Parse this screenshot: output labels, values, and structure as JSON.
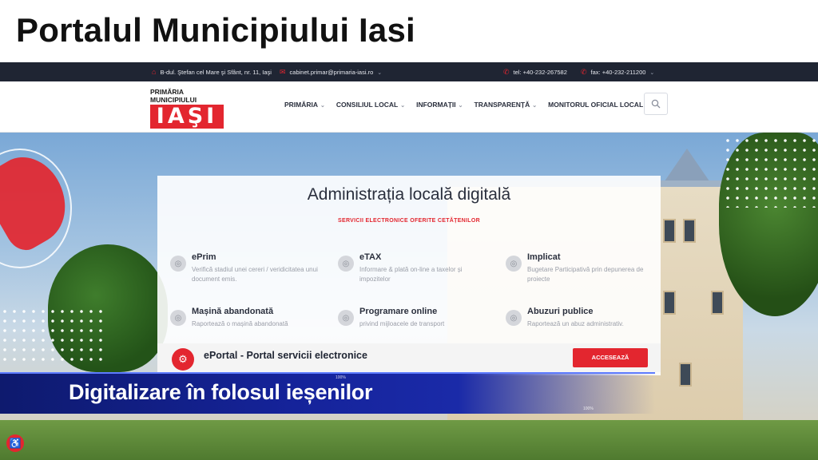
{
  "caption": {
    "title": "Portalul Municipiului Iasi"
  },
  "topbar": {
    "address": "B-dul. Ştefan cel Mare şi Sfânt, nr. 11, Iaşi",
    "email": "cabinet.primar@primaria-iasi.ro",
    "tel": "tel: +40-232-267582",
    "fax": "fax: +40-232-211200"
  },
  "logo": {
    "line1": "PRIMĂRIA",
    "line2": "MUNICIPIULUI",
    "line3": "IAŞI"
  },
  "menu": [
    "PRIMĂRIA",
    "CONSILIUL LOCAL",
    "INFORMAȚII",
    "TRANSPARENȚĂ",
    "MONITORUL OFICIAL LOCAL"
  ],
  "card": {
    "title": "Administrația locală digitală",
    "subtitle": "SERVICII ELECTRONICE OFERITE CETĂȚENILOR",
    "services": [
      {
        "name": "ePrim",
        "desc": "Verifică stadiul unei cereri / veridicitatea unui document emis."
      },
      {
        "name": "eTAX",
        "desc": "Informare & plată on-line a taxelor și impozitelor"
      },
      {
        "name": "Implicat",
        "desc": "Bugetare Participativă prin depunerea de proiecte"
      },
      {
        "name": "Mașină abandonată",
        "desc": "Raportează o mașină abandonată"
      },
      {
        "name": "Programare online",
        "desc": "privind mijloacele de transport"
      },
      {
        "name": "Abuzuri publice",
        "desc": "Raportează un abuz administrativ."
      }
    ],
    "eportal": "ePortal - Portal servicii electronice",
    "access_button": "ACCESEAZĂ"
  },
  "lower_third": {
    "headline": "Digitalizare în folosul ieșenilor",
    "badge": "100%"
  },
  "colors": {
    "brand_red": "#e3262f",
    "topbar": "#1f2533",
    "banner_blue": "#15239a"
  }
}
